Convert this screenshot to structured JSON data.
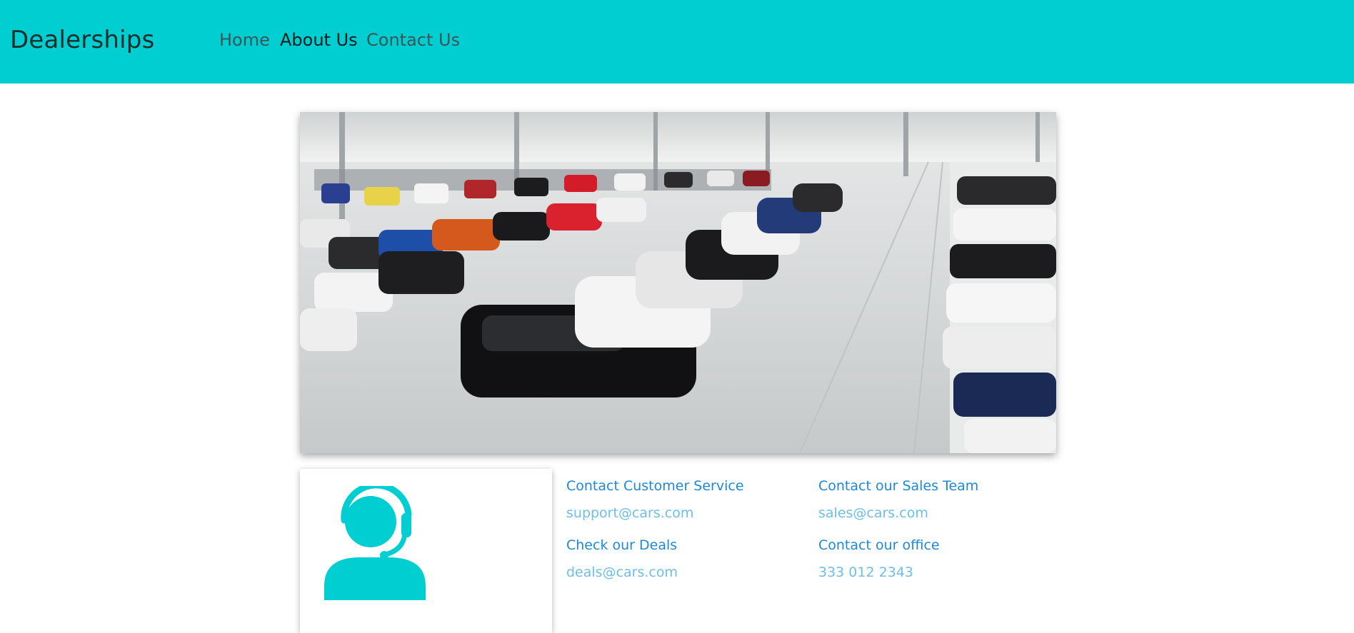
{
  "nav": {
    "brand": "Dealerships",
    "links": [
      "Home",
      "About Us",
      "Contact Us"
    ],
    "active_index": 1,
    "bar_color": "#00ced1"
  },
  "hero": {
    "subject": "car-dealership-showroom-photo"
  },
  "support_card": {
    "icon": "customer-service-headset-icon",
    "icon_color": "#00ced1"
  },
  "contacts": [
    {
      "title": "Contact Customer Service",
      "value": "support@cars.com"
    },
    {
      "title": "Contact our Sales Team",
      "value": "sales@cars.com"
    },
    {
      "title": "Check our Deals",
      "value": "deals@cars.com"
    },
    {
      "title": "Contact our office",
      "value": "333 012 2343"
    }
  ],
  "colors": {
    "contact_title": "#1e88d8",
    "contact_value": "#6dbfe6"
  }
}
